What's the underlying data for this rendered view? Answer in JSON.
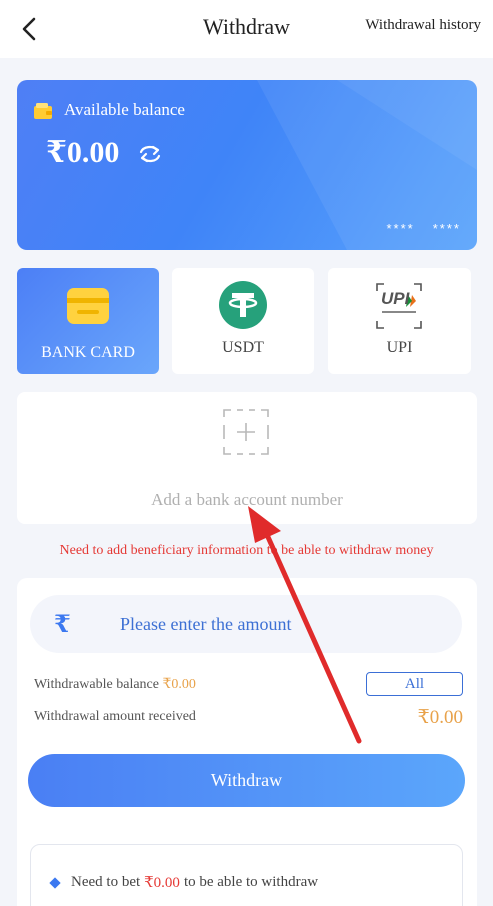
{
  "header": {
    "title": "Withdraw",
    "history_label": "Withdrawal history"
  },
  "balance_card": {
    "label": "Available balance",
    "amount": "₹0.00",
    "mask_1": "****",
    "mask_2": "****"
  },
  "methods": [
    {
      "label": "BANK CARD",
      "icon": "bank-card-icon",
      "active": true
    },
    {
      "label": "USDT",
      "icon": "tether-icon",
      "active": false
    },
    {
      "label": "UPI",
      "icon": "upi-logo",
      "logo_text": "UPI",
      "active": false
    }
  ],
  "add_bank": {
    "text": "Add a bank account number"
  },
  "warning": "Need to add beneficiary information to be able to withdraw money",
  "amount_form": {
    "currency_symbol": "₹",
    "placeholder": "Please enter the amount",
    "withdrawable_label": "Withdrawable balance",
    "withdrawable_value": "₹0.00",
    "all_label": "All",
    "received_label": "Withdrawal amount received",
    "received_value": "₹0.00",
    "submit_label": "Withdraw"
  },
  "note": {
    "prefix": "Need to bet",
    "amount": "₹0.00",
    "suffix": "to be able to withdraw"
  },
  "colors": {
    "accent": "#3b78f0",
    "warning": "#e53935",
    "gold": "#e8a24a",
    "annotation_arrow": "#e02b2b"
  }
}
